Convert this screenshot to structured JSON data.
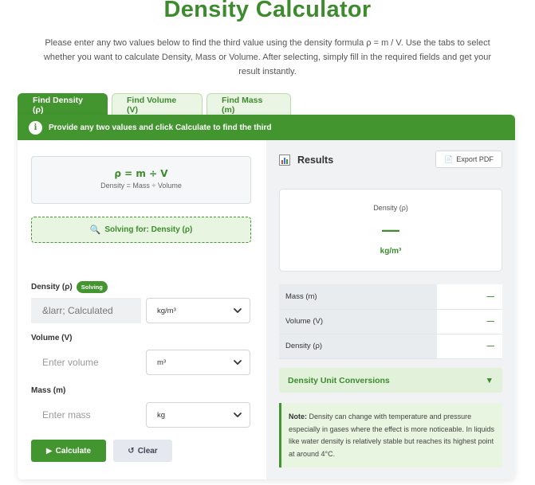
{
  "page": {
    "title": "Density Calculator",
    "intro": "Please enter any two values below to find the third value using the density formula ρ = m / V. Use the tabs to select whether you want to calculate Density, Mass or Volume. After selecting, simply fill in the required fields and get your result instantly."
  },
  "tabs": [
    {
      "label": "Find Density (ρ)",
      "active": true
    },
    {
      "label": "Find Volume (V)",
      "active": false
    },
    {
      "label": "Find Mass (m)",
      "active": false
    }
  ],
  "banner": {
    "icon": "info-icon",
    "text": "Provide any two values and click Calculate to find the third"
  },
  "formula": {
    "main": "ρ = m ÷ V",
    "sub": "Density = Mass ÷ Volume"
  },
  "solving": {
    "icon": "magnifier-icon",
    "text": "Solving for: Density (ρ)"
  },
  "fields": {
    "density": {
      "label": "Density (ρ)",
      "badge": "Solving",
      "value": "&larr; Calculated",
      "unit": "kg/m³"
    },
    "volume": {
      "label": "Volume (V)",
      "placeholder": "Enter volume",
      "unit": "m³"
    },
    "mass": {
      "label": "Mass (m)",
      "placeholder": "Enter mass",
      "unit": "kg"
    }
  },
  "buttons": {
    "calculate": "Calculate",
    "clear": "Clear"
  },
  "results": {
    "title": "Results",
    "export": "Export PDF",
    "main_label": "Density (ρ)",
    "main_value": "—",
    "main_unit": "kg/m³",
    "rows": [
      {
        "label": "Mass (m)",
        "value": "—"
      },
      {
        "label": "Volume (V)",
        "value": "—"
      },
      {
        "label": "Density (ρ)",
        "value": "—"
      }
    ],
    "conversions_label": "Density Unit Conversions",
    "note_prefix": "Note:",
    "note_text": "Density can change with temperature and pressure especially in gases where the effect is more noticeable. In liquids like water density is relatively stable but reaches its highest point at around 4°C."
  },
  "colors": {
    "accent": "#43962f",
    "accent_text": "#3d8b2e",
    "light_green": "#e8f5e1"
  }
}
